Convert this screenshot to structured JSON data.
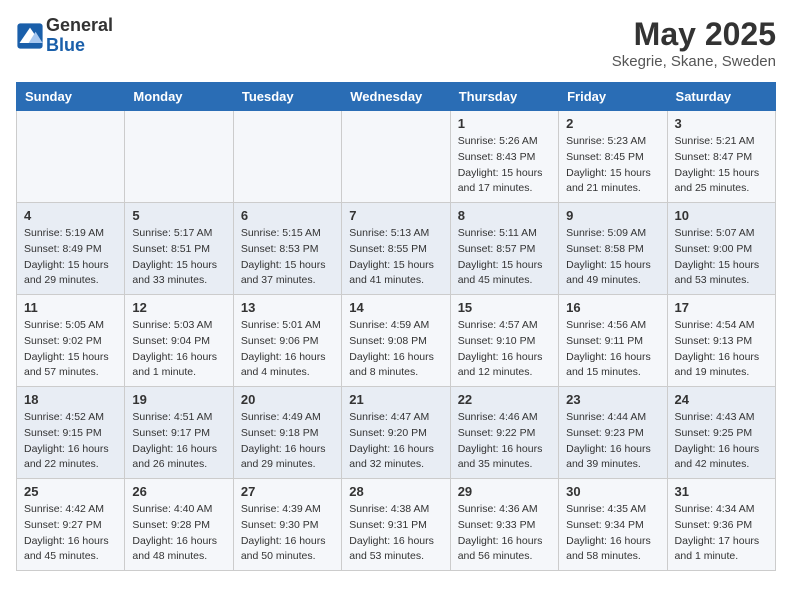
{
  "header": {
    "logo_general": "General",
    "logo_blue": "Blue",
    "month_title": "May 2025",
    "location": "Skegrie, Skane, Sweden"
  },
  "weekdays": [
    "Sunday",
    "Monday",
    "Tuesday",
    "Wednesday",
    "Thursday",
    "Friday",
    "Saturday"
  ],
  "weeks": [
    [
      {
        "day": "",
        "content": ""
      },
      {
        "day": "",
        "content": ""
      },
      {
        "day": "",
        "content": ""
      },
      {
        "day": "",
        "content": ""
      },
      {
        "day": "1",
        "content": "Sunrise: 5:26 AM\nSunset: 8:43 PM\nDaylight: 15 hours\nand 17 minutes."
      },
      {
        "day": "2",
        "content": "Sunrise: 5:23 AM\nSunset: 8:45 PM\nDaylight: 15 hours\nand 21 minutes."
      },
      {
        "day": "3",
        "content": "Sunrise: 5:21 AM\nSunset: 8:47 PM\nDaylight: 15 hours\nand 25 minutes."
      }
    ],
    [
      {
        "day": "4",
        "content": "Sunrise: 5:19 AM\nSunset: 8:49 PM\nDaylight: 15 hours\nand 29 minutes."
      },
      {
        "day": "5",
        "content": "Sunrise: 5:17 AM\nSunset: 8:51 PM\nDaylight: 15 hours\nand 33 minutes."
      },
      {
        "day": "6",
        "content": "Sunrise: 5:15 AM\nSunset: 8:53 PM\nDaylight: 15 hours\nand 37 minutes."
      },
      {
        "day": "7",
        "content": "Sunrise: 5:13 AM\nSunset: 8:55 PM\nDaylight: 15 hours\nand 41 minutes."
      },
      {
        "day": "8",
        "content": "Sunrise: 5:11 AM\nSunset: 8:57 PM\nDaylight: 15 hours\nand 45 minutes."
      },
      {
        "day": "9",
        "content": "Sunrise: 5:09 AM\nSunset: 8:58 PM\nDaylight: 15 hours\nand 49 minutes."
      },
      {
        "day": "10",
        "content": "Sunrise: 5:07 AM\nSunset: 9:00 PM\nDaylight: 15 hours\nand 53 minutes."
      }
    ],
    [
      {
        "day": "11",
        "content": "Sunrise: 5:05 AM\nSunset: 9:02 PM\nDaylight: 15 hours\nand 57 minutes."
      },
      {
        "day": "12",
        "content": "Sunrise: 5:03 AM\nSunset: 9:04 PM\nDaylight: 16 hours\nand 1 minute."
      },
      {
        "day": "13",
        "content": "Sunrise: 5:01 AM\nSunset: 9:06 PM\nDaylight: 16 hours\nand 4 minutes."
      },
      {
        "day": "14",
        "content": "Sunrise: 4:59 AM\nSunset: 9:08 PM\nDaylight: 16 hours\nand 8 minutes."
      },
      {
        "day": "15",
        "content": "Sunrise: 4:57 AM\nSunset: 9:10 PM\nDaylight: 16 hours\nand 12 minutes."
      },
      {
        "day": "16",
        "content": "Sunrise: 4:56 AM\nSunset: 9:11 PM\nDaylight: 16 hours\nand 15 minutes."
      },
      {
        "day": "17",
        "content": "Sunrise: 4:54 AM\nSunset: 9:13 PM\nDaylight: 16 hours\nand 19 minutes."
      }
    ],
    [
      {
        "day": "18",
        "content": "Sunrise: 4:52 AM\nSunset: 9:15 PM\nDaylight: 16 hours\nand 22 minutes."
      },
      {
        "day": "19",
        "content": "Sunrise: 4:51 AM\nSunset: 9:17 PM\nDaylight: 16 hours\nand 26 minutes."
      },
      {
        "day": "20",
        "content": "Sunrise: 4:49 AM\nSunset: 9:18 PM\nDaylight: 16 hours\nand 29 minutes."
      },
      {
        "day": "21",
        "content": "Sunrise: 4:47 AM\nSunset: 9:20 PM\nDaylight: 16 hours\nand 32 minutes."
      },
      {
        "day": "22",
        "content": "Sunrise: 4:46 AM\nSunset: 9:22 PM\nDaylight: 16 hours\nand 35 minutes."
      },
      {
        "day": "23",
        "content": "Sunrise: 4:44 AM\nSunset: 9:23 PM\nDaylight: 16 hours\nand 39 minutes."
      },
      {
        "day": "24",
        "content": "Sunrise: 4:43 AM\nSunset: 9:25 PM\nDaylight: 16 hours\nand 42 minutes."
      }
    ],
    [
      {
        "day": "25",
        "content": "Sunrise: 4:42 AM\nSunset: 9:27 PM\nDaylight: 16 hours\nand 45 minutes."
      },
      {
        "day": "26",
        "content": "Sunrise: 4:40 AM\nSunset: 9:28 PM\nDaylight: 16 hours\nand 48 minutes."
      },
      {
        "day": "27",
        "content": "Sunrise: 4:39 AM\nSunset: 9:30 PM\nDaylight: 16 hours\nand 50 minutes."
      },
      {
        "day": "28",
        "content": "Sunrise: 4:38 AM\nSunset: 9:31 PM\nDaylight: 16 hours\nand 53 minutes."
      },
      {
        "day": "29",
        "content": "Sunrise: 4:36 AM\nSunset: 9:33 PM\nDaylight: 16 hours\nand 56 minutes."
      },
      {
        "day": "30",
        "content": "Sunrise: 4:35 AM\nSunset: 9:34 PM\nDaylight: 16 hours\nand 58 minutes."
      },
      {
        "day": "31",
        "content": "Sunrise: 4:34 AM\nSunset: 9:36 PM\nDaylight: 17 hours\nand 1 minute."
      }
    ]
  ]
}
